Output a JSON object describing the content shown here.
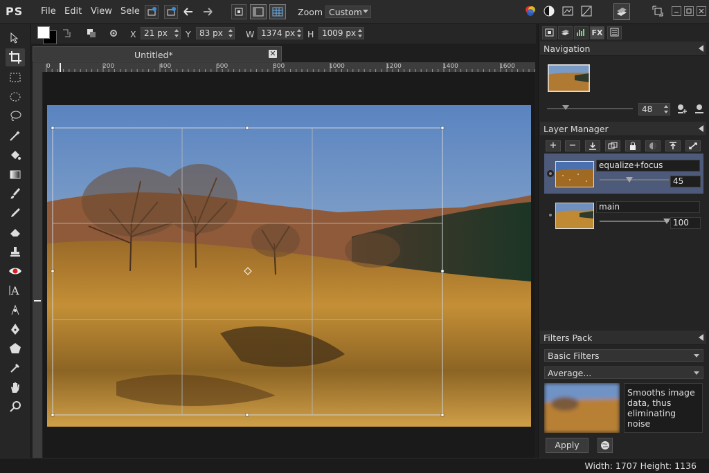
{
  "app": {
    "logo": "PS"
  },
  "menu": {
    "items": [
      "File",
      "Edit",
      "View",
      "Sele"
    ]
  },
  "toolbar": {
    "zoom_label": "Zoom",
    "zoom_value": "Custom"
  },
  "options": {
    "x_label": "X",
    "x_value": "21 px",
    "y_label": "Y",
    "y_value": "83 px",
    "w_label": "W",
    "w_value": "1374 px",
    "h_label": "H",
    "h_value": "1009 px"
  },
  "document": {
    "tab_title": "Untitled*",
    "ruler_labels": [
      "0",
      "200",
      "400",
      "600",
      "800",
      "1000",
      "1200",
      "1400",
      "1600"
    ]
  },
  "panel_tabs": [
    "fx-label"
  ],
  "navigation": {
    "title": "Navigation",
    "zoom_value": "48"
  },
  "layers": {
    "title": "Layer Manager",
    "items": [
      {
        "name": "equalize+focus",
        "opacity": "45",
        "selected": true
      },
      {
        "name": "main",
        "opacity": "100",
        "selected": false
      }
    ]
  },
  "filters": {
    "title": "Filters Pack",
    "category": "Basic Filters",
    "filter": "Average...",
    "description": "Smooths image data, thus eliminating noise",
    "apply_label": "Apply"
  },
  "status": {
    "text": "Width: 1707 Height: 1136"
  },
  "fx_text": "FX",
  "colors": {
    "accent_selected_layer": "#4d5a7a",
    "panel_bg": "#242424"
  }
}
